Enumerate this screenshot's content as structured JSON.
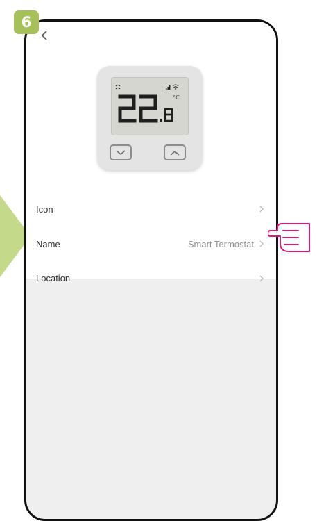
{
  "step": {
    "number": "6"
  },
  "thermostat": {
    "temperature_main": "22",
    "temperature_decimal": "8",
    "unit": "°C"
  },
  "settings": {
    "rows": [
      {
        "label": "Icon",
        "value": ""
      },
      {
        "label": "Name",
        "value": "Smart Termostat"
      },
      {
        "label": "Location",
        "value": ""
      }
    ]
  },
  "colors": {
    "badge": "#a6c15a",
    "arrow": "#c5d98a",
    "hand": "#d81b7a",
    "bottom_background": "#efefef"
  }
}
